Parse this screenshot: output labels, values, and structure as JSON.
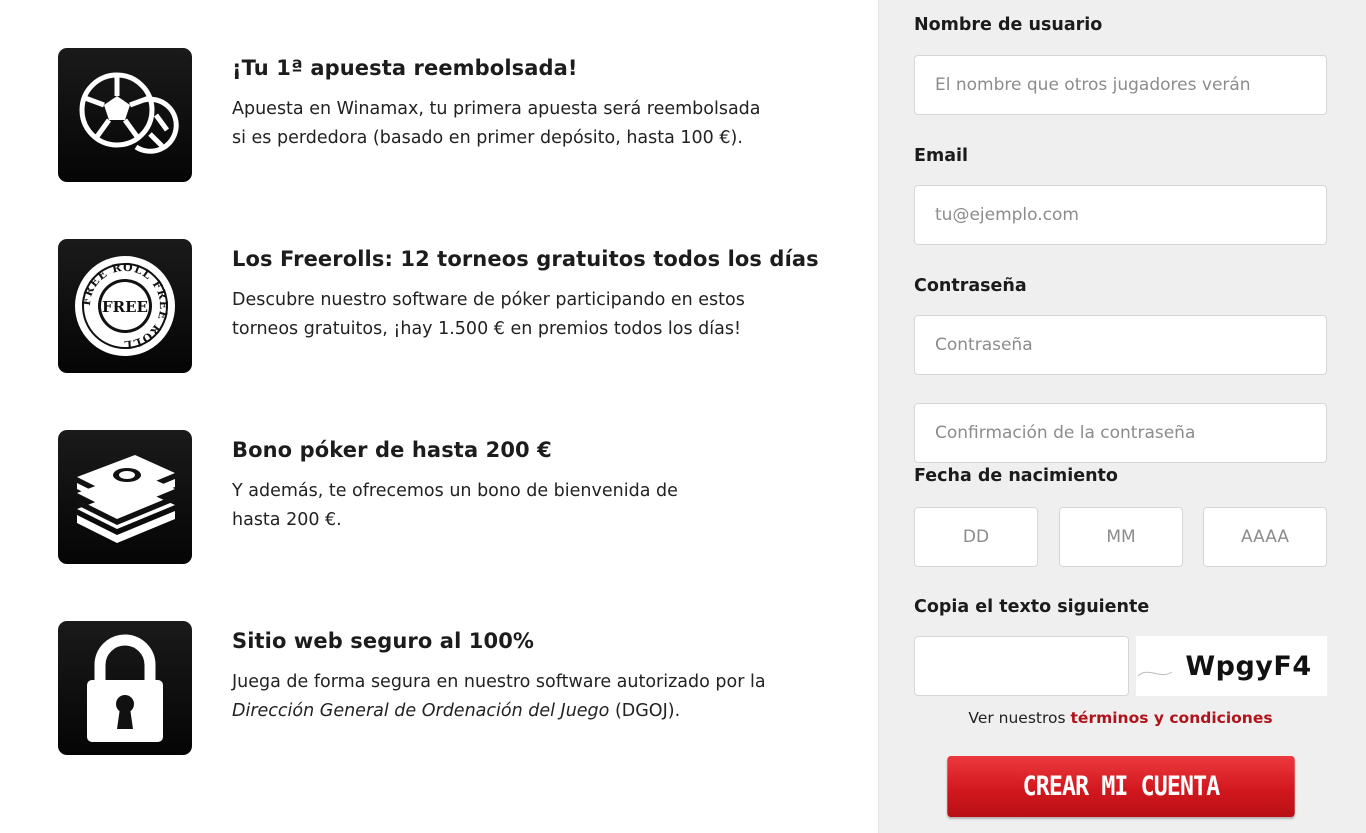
{
  "features": [
    {
      "icon": "soccer-ball-icon",
      "title": "¡Tu 1ª apuesta reembolsada!",
      "desc": "Apuesta en Winamax, tu primera apuesta será reembolsada si es perdedora (basado en primer depósito, hasta 100 €)."
    },
    {
      "icon": "freeroll-chip-icon",
      "title": "Los Freerolls: 12 torneos gratuitos todos los días",
      "desc": "Descubre nuestro software de póker participando en estos torneos gratuitos, ¡hay 1.500 € en premios todos los días!"
    },
    {
      "icon": "money-stack-icon",
      "title": "Bono póker de hasta 200 €",
      "desc": "Y además, te ofrecemos un bono de bienvenida de hasta 200 €."
    },
    {
      "icon": "padlock-icon",
      "title": "Sitio web seguro al 100%",
      "desc_before": "Juega de forma segura en nuestro software autorizado por la ",
      "desc_em": "Dirección General de Ordenación del Juego",
      "desc_after": " (DGOJ)."
    }
  ],
  "chip_text": {
    "center": "FREE",
    "ring": "FREE ROLL FREE ROLL"
  },
  "form": {
    "username_label": "Nombre de usuario",
    "username_placeholder": "El nombre que otros jugadores verán",
    "email_label": "Email",
    "email_placeholder": "tu@ejemplo.com",
    "password_label": "Contraseña",
    "password_placeholder": "Contraseña",
    "password_confirm_placeholder": "Confirmación de la contraseña",
    "birthdate_label": "Fecha de nacimiento",
    "day_placeholder": "DD",
    "month_placeholder": "MM",
    "year_placeholder": "AAAA",
    "captcha_label": "Copia el texto siguiente",
    "captcha_value": "",
    "captcha_text": "WpgyF4",
    "terms_prefix": "Ver nuestros ",
    "terms_link": "términos y condiciones",
    "submit_label": "CREAR MI CUENTA"
  },
  "colors": {
    "accent_red": "#d2181e",
    "terms_link": "#b0141b",
    "panel_bg": "#efefef",
    "icon_tile": "#0d0d0d"
  }
}
